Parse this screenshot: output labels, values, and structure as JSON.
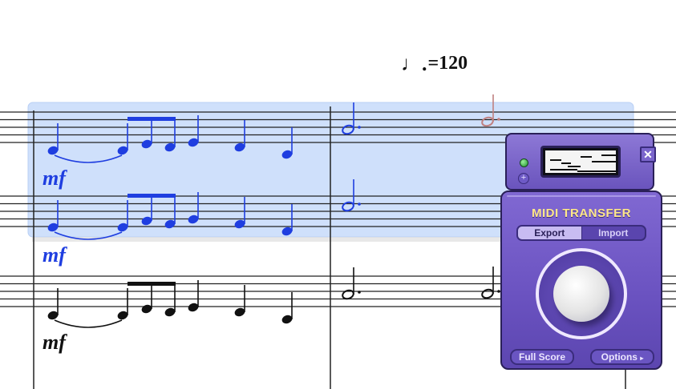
{
  "score": {
    "tempo_text": "=120",
    "tempo_note_icon": "dotted-quarter-note-icon",
    "dynamics": [
      "mf",
      "mf",
      "mf"
    ],
    "selection_color": "#cfe0fb",
    "selected_note_color": "#1f3ee0",
    "normal_note_color": "#111111"
  },
  "widget": {
    "title": "MIDI TRANSFER",
    "tabs": [
      {
        "label": "Export",
        "active": true
      },
      {
        "label": "Import",
        "active": false
      }
    ],
    "full_score_label": "Full Score",
    "options_label": "Options",
    "close_label": "✕",
    "plus_label": "+",
    "accent_color": "#6a52c0",
    "title_color": "#ffe88a"
  }
}
